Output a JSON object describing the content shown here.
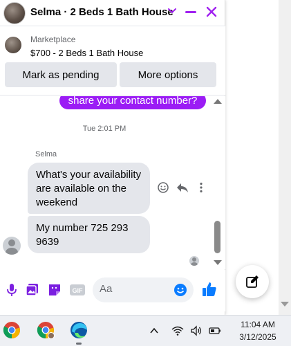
{
  "chat": {
    "title": "Selma · 2 Beds 1 Bath House",
    "accent_color": "#a020f0"
  },
  "marketplace": {
    "label": "Marketplace",
    "listing": "$700 - 2 Beds 1 Bath House",
    "mark_pending_label": "Mark as pending",
    "more_options_label": "More options"
  },
  "messages": {
    "outgoing_partial": "share your contact number?",
    "timestamp": "Tue 2:01 PM",
    "sender": "Selma",
    "incoming": [
      "What's your availability are available on the weekend",
      "My number 725 293 9639"
    ]
  },
  "composer": {
    "placeholder": "Aa",
    "icons": [
      "microphone-icon",
      "image-icon",
      "sticker-icon",
      "gif-icon",
      "emoji-icon",
      "thumbs-up-icon"
    ]
  },
  "taskbar": {
    "time": "11:04 AM",
    "date": "3/12/2025",
    "apps": [
      "chrome-icon",
      "chrome-profile-icon",
      "edge-icon"
    ],
    "tray": [
      "chevron-up-icon",
      "wifi-icon",
      "volume-icon",
      "battery-icon"
    ]
  }
}
